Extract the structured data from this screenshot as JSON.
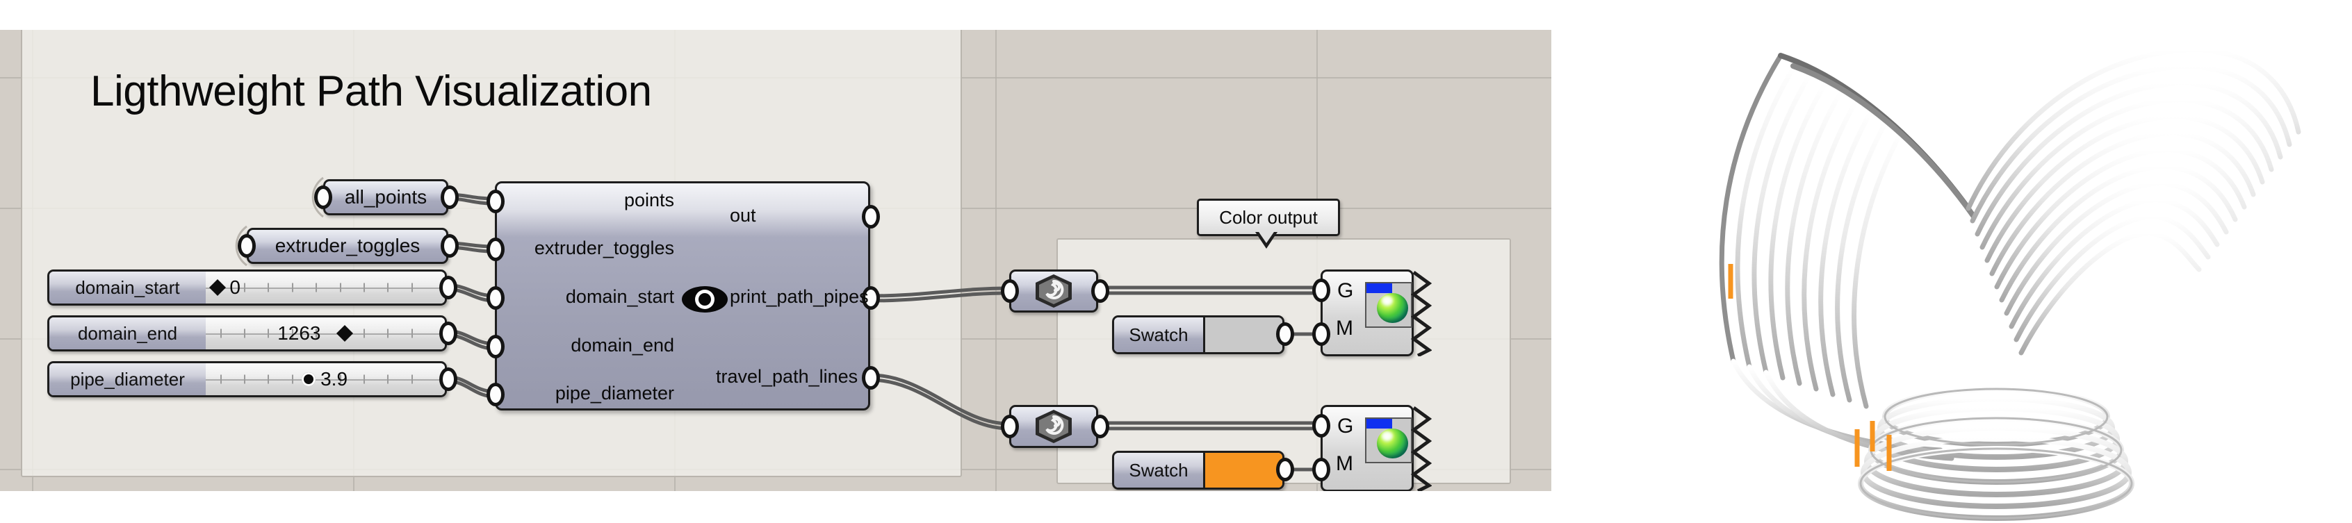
{
  "app": {
    "environment": "Grasshopper canvas",
    "canvas_background": "#d3cec7",
    "group_background": "#f1f0eb",
    "viewport_background": "#ffffff"
  },
  "group_title": {
    "text": "Ligthweight Path Visualization"
  },
  "params": [
    {
      "name": "all_points",
      "label": "all_points",
      "kind": "wireless-param"
    },
    {
      "name": "extruder_toggles",
      "label": "extruder_toggles",
      "kind": "wireless-param"
    }
  ],
  "sliders": [
    {
      "name": "domain_start",
      "label": "domain_start",
      "value": "0",
      "handle": "diamond",
      "handle_pct": 3,
      "value_side": "right-of-handle"
    },
    {
      "name": "domain_end",
      "label": "domain_end",
      "value": "1263",
      "handle": "diamond",
      "handle_pct": 59,
      "value_side": "left-of-handle"
    },
    {
      "name": "pipe_diameter",
      "label": "pipe_diameter",
      "value": "3.9",
      "handle": "circle",
      "handle_pct": 42,
      "value_side": "right-of-handle"
    }
  ],
  "main_component": {
    "name": "lightweight-path-visualization-component",
    "inputs": [
      "points",
      "extruder_toggles",
      "domain_start",
      "domain_end",
      "pipe_diameter"
    ],
    "outputs": [
      "out",
      "print_path_pipes",
      "travel_path_lines"
    ],
    "preview_toggle": "eye-icon",
    "body_color": "#a1a3b6"
  },
  "color_group": {
    "label": "Color output",
    "rows": [
      {
        "name": "print-path-row",
        "entwine_icon": "spiral-icon",
        "swatch_label": "Swatch",
        "swatch_color": "#c9c9c9",
        "preview": {
          "inputs": [
            "G",
            "M"
          ],
          "icon": "custom-preview-icon"
        }
      },
      {
        "name": "travel-path-row",
        "entwine_icon": "spiral-icon",
        "swatch_label": "Swatch",
        "swatch_color": "#f79520",
        "preview": {
          "inputs": [
            "G",
            "M"
          ],
          "icon": "custom-preview-icon"
        }
      }
    ]
  },
  "viewport": {
    "name": "rhino-3d-viewport",
    "description": "3D print toolpath preview",
    "pipe_color": "#d9d9d9",
    "travel_color": "#f79520"
  }
}
